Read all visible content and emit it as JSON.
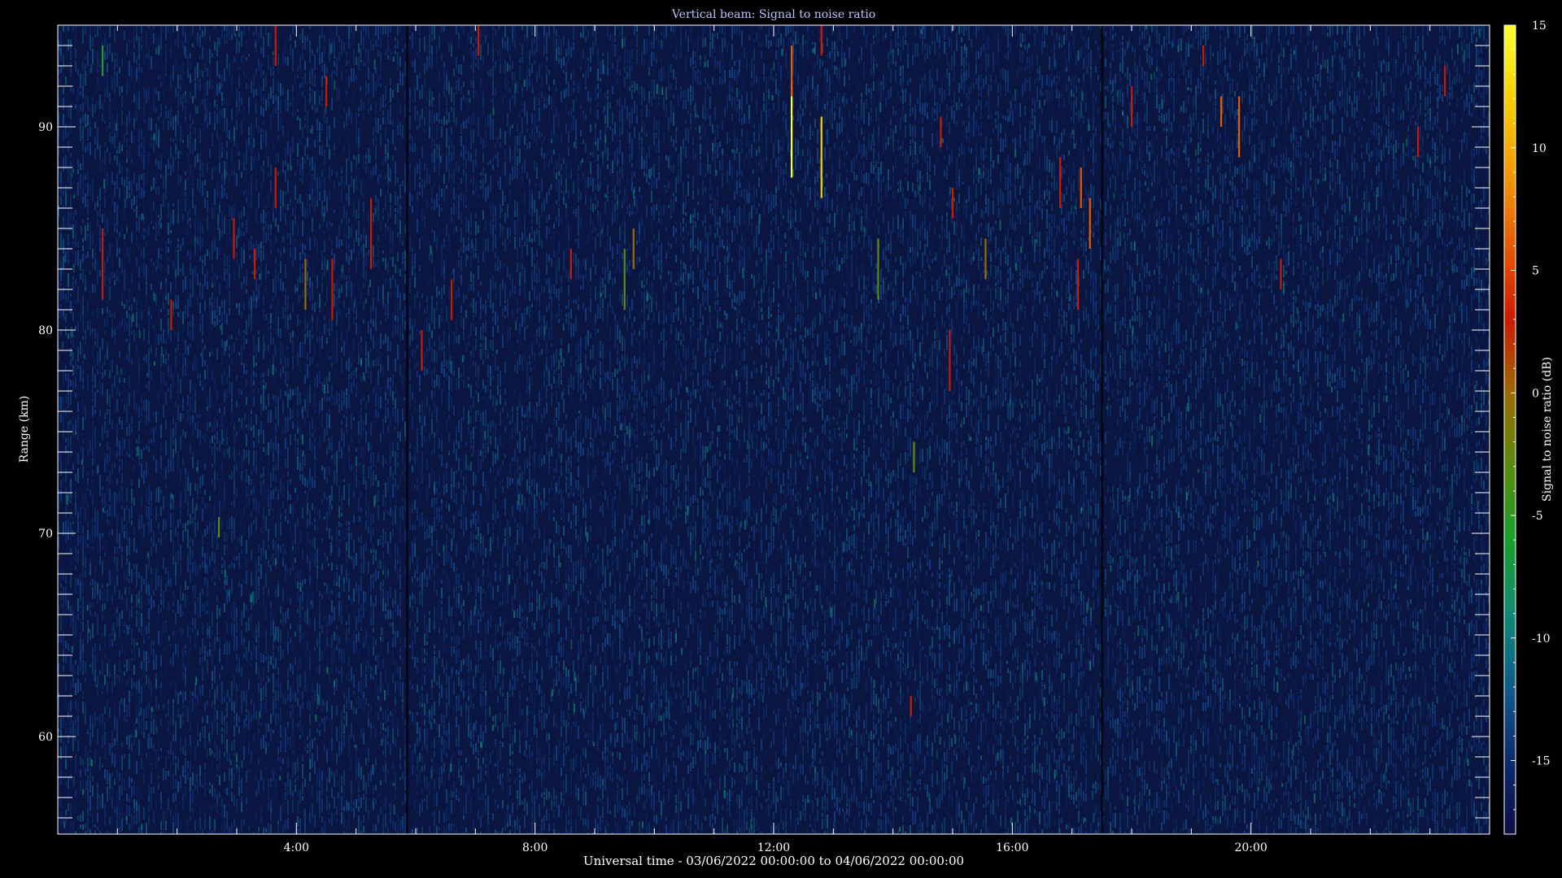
{
  "chart_data": {
    "type": "heatmap",
    "title": "Vertical beam: Signal to noise ratio",
    "xlabel": "Universal time - 03/06/2022 00:00:00 to 04/06/2022 00:00:00",
    "ylabel": "Range (km)",
    "colorbar_label": "Signal to noise ratio (dB)",
    "x_units": "hours UT",
    "xlim": [
      0,
      24
    ],
    "ylim": [
      55.2,
      95.0
    ],
    "color_range": [
      -18,
      15
    ],
    "x_ticks": [
      {
        "value": 4,
        "label": "4:00"
      },
      {
        "value": 8,
        "label": "8:00"
      },
      {
        "value": 12,
        "label": "12:00"
      },
      {
        "value": 16,
        "label": "16:00"
      },
      {
        "value": 20,
        "label": "20:00"
      }
    ],
    "y_ticks": [
      {
        "value": 60,
        "label": "60"
      },
      {
        "value": 70,
        "label": "70"
      },
      {
        "value": 80,
        "label": "80"
      },
      {
        "value": 90,
        "label": "90"
      }
    ],
    "colorbar_ticks": [
      {
        "value": 15,
        "label": "15"
      },
      {
        "value": 10,
        "label": "10"
      },
      {
        "value": 5,
        "label": "5"
      },
      {
        "value": 0,
        "label": "0"
      },
      {
        "value": -5,
        "label": "-5"
      },
      {
        "value": -10,
        "label": "-10"
      },
      {
        "value": -15,
        "label": "-15"
      }
    ],
    "background_level_db": [
      -16,
      -12
    ],
    "data_gaps_hours": [
      5.85,
      17.5
    ],
    "echoes": [
      {
        "t": 0.75,
        "range": [
          81.5,
          85.0
        ],
        "snr": 3
      },
      {
        "t": 0.75,
        "range": [
          92.5,
          94.0
        ],
        "snr": -5
      },
      {
        "t": 1.9,
        "range": [
          80.0,
          81.5
        ],
        "snr": 2
      },
      {
        "t": 2.7,
        "range": [
          69.8,
          70.8
        ],
        "snr": -4
      },
      {
        "t": 2.95,
        "range": [
          83.5,
          85.5
        ],
        "snr": 2
      },
      {
        "t": 3.3,
        "range": [
          82.5,
          84.0
        ],
        "snr": 3
      },
      {
        "t": 3.65,
        "range": [
          86.0,
          88.0
        ],
        "snr": 3
      },
      {
        "t": 3.65,
        "range": [
          93.0,
          95.0
        ],
        "snr": 2
      },
      {
        "t": 4.15,
        "range": [
          81.0,
          83.5
        ],
        "snr": 1
      },
      {
        "t": 4.5,
        "range": [
          91.0,
          92.5
        ],
        "snr": 2
      },
      {
        "t": 4.6,
        "range": [
          80.5,
          83.5
        ],
        "snr": 4
      },
      {
        "t": 5.25,
        "range": [
          83.0,
          86.5
        ],
        "snr": 2
      },
      {
        "t": 6.1,
        "range": [
          78.0,
          80.0
        ],
        "snr": 3
      },
      {
        "t": 6.6,
        "range": [
          80.5,
          82.5
        ],
        "snr": 3
      },
      {
        "t": 7.05,
        "range": [
          93.5,
          95.0
        ],
        "snr": 2
      },
      {
        "t": 8.6,
        "range": [
          82.5,
          84.0
        ],
        "snr": 2
      },
      {
        "t": 9.5,
        "range": [
          81.0,
          84.0
        ],
        "snr": -4
      },
      {
        "t": 9.65,
        "range": [
          83.0,
          85.0
        ],
        "snr": 1
      },
      {
        "t": 12.3,
        "range": [
          87.5,
          92.0
        ],
        "snr": 14
      },
      {
        "t": 12.3,
        "range": [
          91.5,
          94.0
        ],
        "snr": 5
      },
      {
        "t": 12.8,
        "range": [
          86.5,
          90.5
        ],
        "snr": 12
      },
      {
        "t": 12.8,
        "range": [
          93.5,
          95.0
        ],
        "snr": 3
      },
      {
        "t": 13.75,
        "range": [
          81.5,
          84.5
        ],
        "snr": -4
      },
      {
        "t": 14.3,
        "range": [
          61.0,
          62.0
        ],
        "snr": 2
      },
      {
        "t": 14.35,
        "range": [
          73.0,
          74.5
        ],
        "snr": -4
      },
      {
        "t": 14.8,
        "range": [
          89.0,
          90.5
        ],
        "snr": 3
      },
      {
        "t": 14.95,
        "range": [
          77.0,
          80.0
        ],
        "snr": 2
      },
      {
        "t": 15.0,
        "range": [
          85.5,
          87.0
        ],
        "snr": 2
      },
      {
        "t": 15.55,
        "range": [
          82.5,
          84.5
        ],
        "snr": 1
      },
      {
        "t": 16.8,
        "range": [
          86.0,
          88.5
        ],
        "snr": 4
      },
      {
        "t": 17.15,
        "range": [
          86.0,
          88.0
        ],
        "snr": 5
      },
      {
        "t": 17.1,
        "range": [
          81.0,
          83.5
        ],
        "snr": 3
      },
      {
        "t": 17.3,
        "range": [
          84.0,
          86.5
        ],
        "snr": 5
      },
      {
        "t": 18.0,
        "range": [
          90.0,
          92.0
        ],
        "snr": 3
      },
      {
        "t": 19.2,
        "range": [
          93.0,
          94.0
        ],
        "snr": 4
      },
      {
        "t": 19.5,
        "range": [
          90.0,
          91.5
        ],
        "snr": 6
      },
      {
        "t": 19.8,
        "range": [
          88.5,
          91.5
        ],
        "snr": 7
      },
      {
        "t": 20.5,
        "range": [
          82.0,
          83.5
        ],
        "snr": 2
      },
      {
        "t": 22.8,
        "range": [
          88.5,
          90.0
        ],
        "snr": 3
      },
      {
        "t": 23.25,
        "range": [
          91.5,
          93.0
        ],
        "snr": 2
      }
    ]
  },
  "colors": {
    "background": "#000000",
    "plot_base": "#0a1540",
    "frame": "#ffffff",
    "title": "#b8c6ff",
    "colormap": [
      "#0c0d45",
      "#0d2a6e",
      "#0e5b8a",
      "#0f8a74",
      "#17a02a",
      "#5a8a10",
      "#9b6a00",
      "#cc1a00",
      "#e85a00",
      "#f39a00",
      "#f7cf00",
      "#ffff33"
    ]
  }
}
